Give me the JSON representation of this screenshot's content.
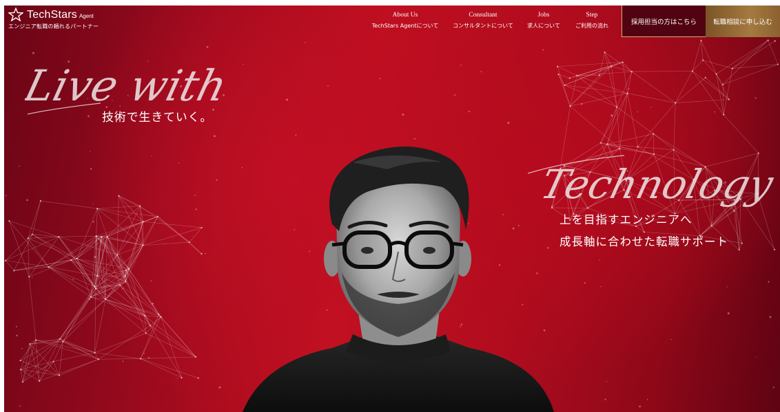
{
  "brand": {
    "name": "TechStars",
    "sub": "Agent",
    "tagline": "エンジニア転職の頼れるパートナー"
  },
  "nav": [
    {
      "en": "About Us",
      "jp": "TechStars Agentについて"
    },
    {
      "en": "Consultant",
      "jp": "コンサルタントについて"
    },
    {
      "en": "Jobs",
      "jp": "求人について"
    },
    {
      "en": "Step",
      "jp": "ご利用の流れ"
    }
  ],
  "buttons": {
    "recruiter": "採用担当の方はこちら",
    "apply": "転職相談に申し込む"
  },
  "hero": {
    "script_left": "Live with",
    "headline_left": "技術で生きていく。",
    "script_right": "Technology",
    "headline_right_1": "上を目指すエンジニアへ",
    "headline_right_2": "成長軸に合わせた転職サポート"
  },
  "colors": {
    "primary_red": "#c0101f",
    "dark_red": "#6a0516",
    "gold": "#a47a40"
  }
}
